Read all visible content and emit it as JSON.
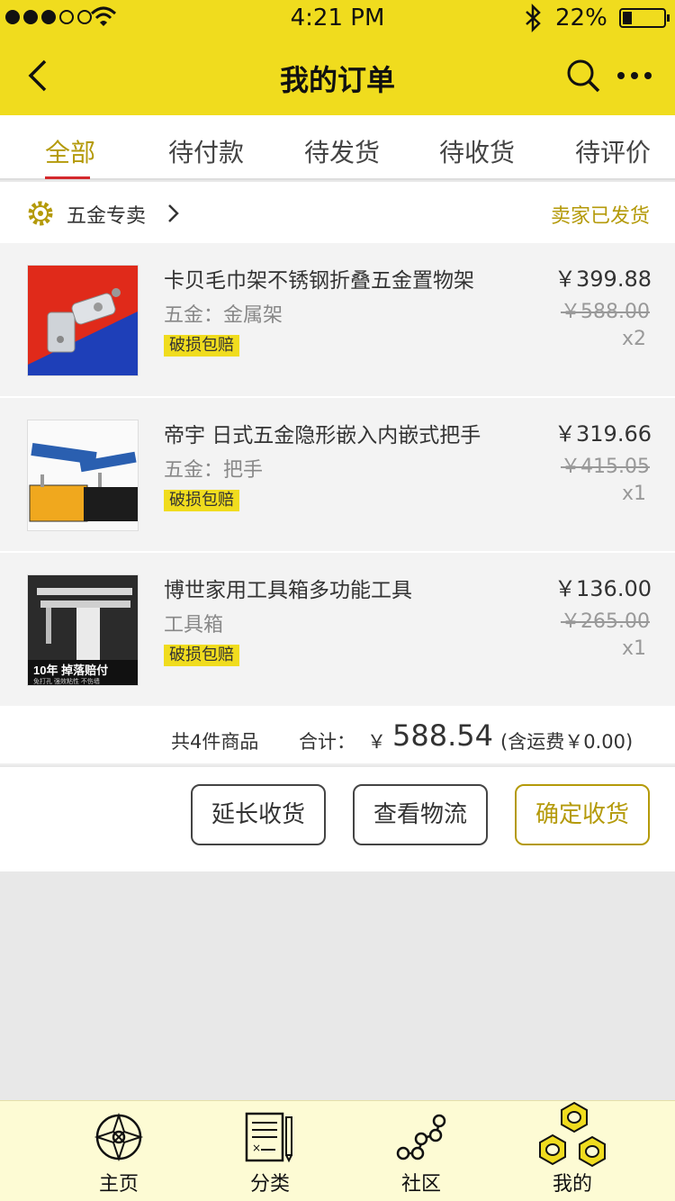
{
  "status_bar": {
    "time": "4:21 PM",
    "battery_percent": "22%",
    "battery_level": 0.22
  },
  "header": {
    "title": "我的订单"
  },
  "tabs": [
    {
      "label": "全部"
    },
    {
      "label": "待付款"
    },
    {
      "label": "待发货"
    },
    {
      "label": "待收货"
    },
    {
      "label": "待评价"
    }
  ],
  "store": {
    "name": "五金专卖",
    "status": "卖家已发货"
  },
  "items": [
    {
      "name": "卡贝毛巾架不锈钢折叠五金置物架",
      "spec": "五金：金属架",
      "badge": "破损包赔",
      "price": "￥399.88",
      "original_price": "￥588.00",
      "qty": "x2"
    },
    {
      "name": "帝宇 日式五金隐形嵌入内嵌式把手",
      "spec": "五金：把手",
      "badge": "破损包赔",
      "price": "￥319.66",
      "original_price": "￥415.05",
      "qty": "x1"
    },
    {
      "name": "博世家用工具箱多功能工具",
      "spec": "工具箱",
      "badge": "破损包赔",
      "price": "￥136.00",
      "original_price": "￥265.00",
      "qty": "x1"
    }
  ],
  "thumb_text": {
    "headline": "10年 掉落赔付",
    "sub": "免打孔 强效粘性 不伤墙"
  },
  "summary": {
    "count": "共4件商品",
    "total_label": "合计：",
    "currency": "￥",
    "total": "588.54",
    "shipping": "(含运费￥0.00)"
  },
  "actions": {
    "extend": "延长收货",
    "logistics": "查看物流",
    "confirm": "确定收货"
  },
  "bottom_nav": [
    {
      "label": "主页"
    },
    {
      "label": "分类"
    },
    {
      "label": "社区"
    },
    {
      "label": "我的"
    }
  ],
  "colors": {
    "accent": "#f0dc1e",
    "accent_text": "#b49a0a",
    "active_underline": "#d4292c"
  }
}
